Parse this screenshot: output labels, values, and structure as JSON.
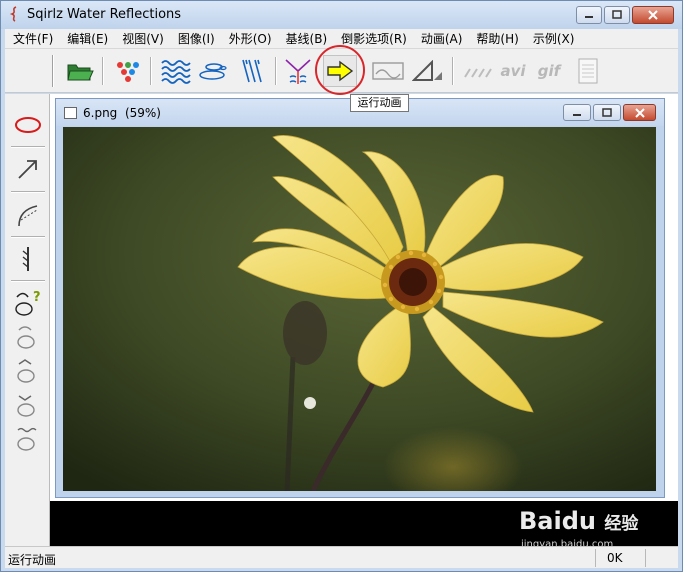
{
  "window": {
    "title": "Sqirlz Water Reflections",
    "app_icon": "sqirlz-app-icon",
    "controls": [
      "minimize-icon",
      "maximize-icon",
      "close-icon"
    ]
  },
  "menu": [
    "文件(F)",
    "编辑(E)",
    "视图(V)",
    "图像(I)",
    "外形(O)",
    "基线(B)",
    "倒影选项(R)",
    "动画(A)",
    "帮助(H)",
    "示例(X)"
  ],
  "toolbar": {
    "buttons": [
      {
        "name": "open-folder-icon"
      },
      {
        "name": "color-dots-icon"
      },
      {
        "name": "waves-icon"
      },
      {
        "name": "ripples-icon"
      },
      {
        "name": "rain-lines-icon"
      },
      {
        "name": "distort-funnel-icon"
      },
      {
        "name": "run-animation-arrow-icon"
      },
      {
        "name": "landscape-frame-icon"
      },
      {
        "name": "perspective-triangle-icon"
      },
      {
        "name": "slashes-icon"
      },
      {
        "name": "avi-icon",
        "label": "avi"
      },
      {
        "name": "gif-icon",
        "label": "gif"
      },
      {
        "name": "document-icon"
      }
    ],
    "tooltip": "运行动画",
    "highlight_color": "#d9262a",
    "active_arrow_color": "#ffff00"
  },
  "left_tools": [
    {
      "name": "ellipse-tool-icon"
    },
    {
      "name": "arrow-tool-icon"
    },
    {
      "name": "curve-tool-icon"
    },
    {
      "name": "line-marker-icon"
    },
    {
      "name": "shape-help-icon"
    },
    {
      "name": "shape-1-icon"
    },
    {
      "name": "shape-2-icon"
    },
    {
      "name": "shape-3-icon"
    },
    {
      "name": "shape-4-icon"
    }
  ],
  "document": {
    "file": "6.png",
    "zoom": "(59%)",
    "image_description": "yellow dahlia flower on dark green blurred background"
  },
  "status": {
    "left": "运行动画",
    "right": "0K"
  },
  "watermark": {
    "brand": "Bai",
    "brand2": "du",
    "suffix": "经验",
    "url": "jingyan.baidu.com"
  }
}
